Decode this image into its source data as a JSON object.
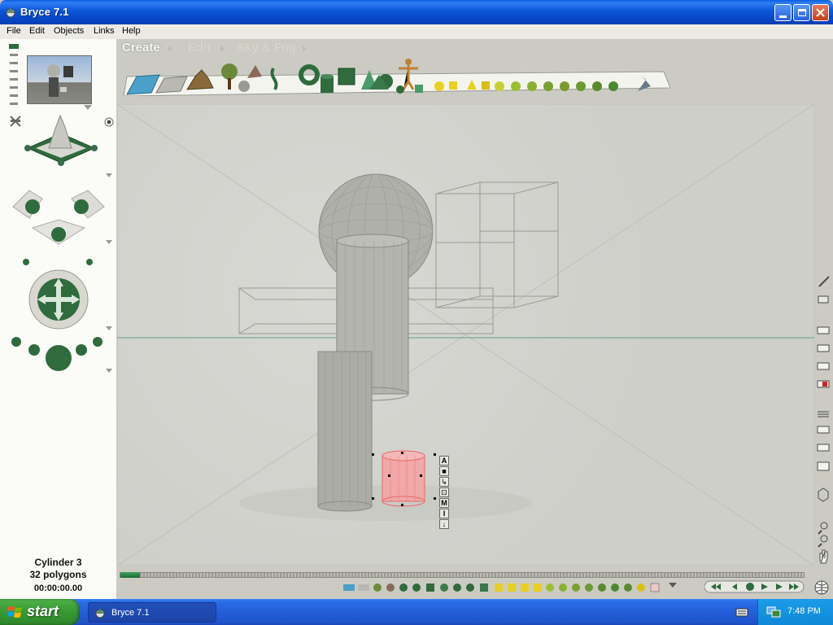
{
  "window": {
    "title": "Bryce 7.1",
    "buttons": [
      "minimize",
      "maximize",
      "close"
    ]
  },
  "menu": {
    "items": [
      "File",
      "Edit",
      "Objects",
      "Links",
      "Help"
    ]
  },
  "palettes": {
    "tabs": [
      "Create",
      "Edit",
      "Sky & Fog"
    ],
    "active_tab": "Create"
  },
  "create_shelf": {
    "items": [
      "water-plane",
      "ground-plane",
      "terrain",
      "tree",
      "stone",
      "rock",
      "symmetrical-lattice",
      "torus",
      "cylinder",
      "cube",
      "cone",
      "sphere",
      "pyramid",
      "human-figure",
      "disc",
      "square",
      "primitive-yellow-shapes",
      "star-shape"
    ]
  },
  "left_panel": {
    "controls": [
      "view-presets",
      "camera-preview",
      "trackball-fountain",
      "camera-crosses",
      "camera-trackball",
      "render-spheres"
    ]
  },
  "selection_tools": [
    "A",
    "■",
    "↳",
    "⊡",
    "M",
    "I",
    "↓"
  ],
  "object_info": {
    "name": "Cylinder 3",
    "polygons": "32 polygons",
    "time": "00:00:00.00"
  },
  "taskbar": {
    "start_label": "start",
    "task_label": "Bryce 7.1",
    "clock": "7:48 PM"
  },
  "colors": {
    "viewport": "#cfcfca",
    "selection": "#e86a6a",
    "accent_green": "#2f6b3c",
    "horizon": "#5da38a",
    "xp_blue": "#245ed8"
  }
}
